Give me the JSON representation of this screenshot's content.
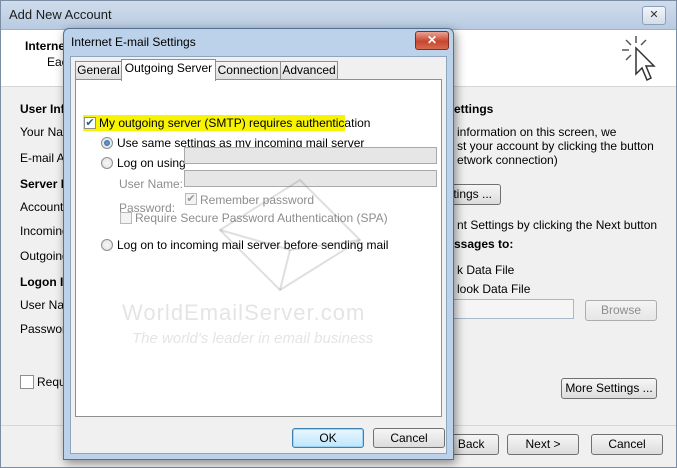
{
  "background_window": {
    "title": "Add New Account",
    "close_glyph": "✕",
    "header_title": "Interne",
    "header_subtitle": "Eac",
    "user_info_heading": "User Inf",
    "your_name_label": "Your Nam",
    "email_label": "E-mail Ad",
    "server_info_heading": "Server I",
    "account_type_label": "Account T",
    "incoming_label": "Incoming",
    "outgoing_label": "Outgoing",
    "logon_info_heading": "Logon I",
    "username_label": "User Nam",
    "password_label": "Password",
    "require_label": "Requi",
    "test_heading": "ettings",
    "test_desc_1": "information on this screen, we",
    "test_desc_2": "st your account by clicking the button",
    "test_desc_3": "etwork connection)",
    "test_button": "ttings ...",
    "next_desc": "nt Settings by clicking the Next button",
    "deliver_heading": "ssages to:",
    "new_data_file": "k Data File",
    "existing_data_file": "look Data File",
    "browse_button": "Browse",
    "more_settings_button": "More Settings ...",
    "back_button": "< Back",
    "next_button": "Next >",
    "cancel_button": "Cancel"
  },
  "dialog": {
    "title": "Internet E-mail Settings",
    "close_glyph": "✕",
    "tabs": [
      {
        "label": "General"
      },
      {
        "label": "Outgoing Server"
      },
      {
        "label": "Connection"
      },
      {
        "label": "Advanced"
      }
    ],
    "smtp_auth_label": "My outgoing server (SMTP) requires authentication",
    "smtp_auth_checked": true,
    "use_same_label": "Use same settings as my incoming mail server",
    "log_on_using_label": "Log on using",
    "user_name_label": "User Name:",
    "user_name_value": "",
    "password_label": "Password:",
    "password_value": "",
    "remember_password_label": "Remember password",
    "remember_password_checked": true,
    "spa_label": "Require Secure Password Authentication (SPA)",
    "log_on_incoming_label": "Log on to incoming mail server before sending mail",
    "selected_option": "use_same",
    "ok_button": "OK",
    "cancel_button": "Cancel",
    "check_glyph": "✔"
  },
  "watermark": {
    "line1": "WorldEmailServer.com",
    "line2": "The world's leader in email business"
  }
}
